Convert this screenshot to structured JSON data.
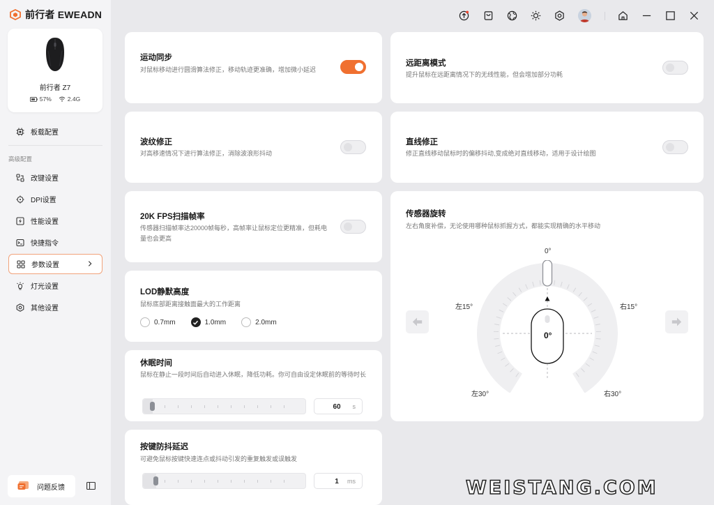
{
  "app": {
    "brand": "前行者 EWEADN"
  },
  "device": {
    "name": "前行者 Z7",
    "battery": "57%",
    "connection": "2.4G"
  },
  "sidebar": {
    "board_config": "板载配置",
    "section_label": "高级配置",
    "items": [
      {
        "label": "改键设置"
      },
      {
        "label": "DPI设置"
      },
      {
        "label": "性能设置"
      },
      {
        "label": "快捷指令"
      },
      {
        "label": "参数设置",
        "active": true
      },
      {
        "label": "灯光设置"
      },
      {
        "label": "其他设置"
      }
    ],
    "feedback": "问题反馈"
  },
  "settings": {
    "motion_sync": {
      "title": "运动同步",
      "desc": "对鼠标移动进行圆滑算法修正，移动轨迹更准确，增加微小延迟",
      "enabled": true
    },
    "long_range": {
      "title": "远距离模式",
      "desc": "提升鼠标在远距离情况下的无线性能，但会增加部分功耗",
      "enabled": false
    },
    "ripple": {
      "title": "波纹修正",
      "desc": "对高移速情况下进行算法修正，消除波浪形抖动",
      "enabled": false
    },
    "straight": {
      "title": "直线修正",
      "desc": "修正直线移动鼠标时的偏移抖动,变成绝对直线移动，适用于设计绘图",
      "enabled": false
    },
    "fps": {
      "title": "20K FPS扫描帧率",
      "desc": "传感器扫描帧率达20000帧每秒，高帧率让鼠标定位更精准，但耗电量也会更高",
      "enabled": false
    },
    "lod": {
      "title": "LOD静默高度",
      "desc": "鼠标底部距离接触面最大的工作距离",
      "options": [
        "0.7mm",
        "1.0mm",
        "2.0mm"
      ],
      "selected": "1.0mm"
    },
    "sleep": {
      "title": "休眠时间",
      "desc": "鼠标在静止一段时间后自动进入休眠，降低功耗。你可自由设定休眠前的等待时长",
      "value": "60",
      "unit": "s",
      "level": 0.02
    },
    "debounce": {
      "title": "按键防抖延迟",
      "desc": "可避免鼠标按键快速连点或抖动引发的重复触发或误触发",
      "value": "1",
      "unit": "ms",
      "level": 0.04
    },
    "sensor_rotation": {
      "title": "传感器旋转",
      "desc": "左右角度补偿，无论使用哪种鼠标抓握方式，都能实现精确的水平移动",
      "top_label": "0°",
      "left15": "左15°",
      "right15": "右15°",
      "left30": "左30°",
      "right30": "右30°",
      "current": "0°"
    }
  },
  "watermark": "WEISTANG.COM",
  "colors": {
    "accent": "#f07030",
    "active_border": "#f1a27a"
  }
}
